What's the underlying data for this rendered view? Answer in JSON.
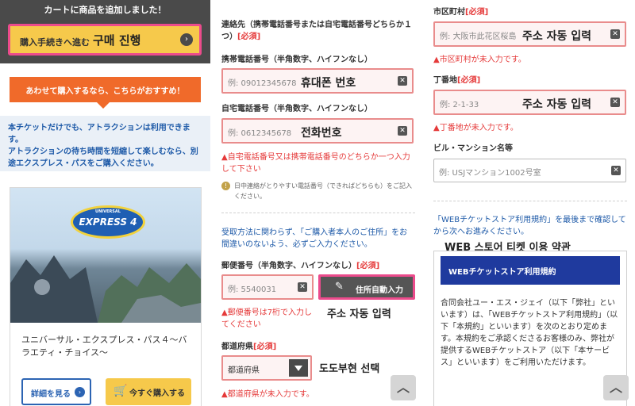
{
  "cart": {
    "message": "カートに商品を追加しました！",
    "checkout_jp": "購入手続きへ進む",
    "checkout_ko": "구매 진행",
    "chevron": "›"
  },
  "recommend": {
    "banner": "あわせて購入するなら、こちらがおすすめ！",
    "info": "本チケットだけでも、アトラクションは利用できます。\nアトラクションの待ち時間を短縮して楽しむなら、別途エクスプレス・パスをご購入ください。"
  },
  "product": {
    "logo_small": "UNIVERSAL",
    "logo_text": "EXPRESS 4",
    "name": "ユニバーサル・エクスプレス・パス４～バラエティ・チョイス～",
    "details_label": "詳細を見る",
    "details_chevron": "›",
    "cart_icon": "🛒",
    "buy_label": "今すぐ購入する"
  },
  "contact": {
    "label": "連絡先（携帯電話番号または自宅電話番号どちらか１つ）",
    "required": "[必須]",
    "mobile_label": "携帯電話番号（半角数字、ハイフンなし）",
    "mobile_placeholder": "例: 09012345678",
    "mobile_ko": "휴대폰 번호",
    "home_label": "自宅電話番号（半角数字、ハイフンなし）",
    "home_placeholder": "例: 0612345678",
    "home_ko": "전화번호",
    "error": "▲自宅電話番号又は携帯電話番号のどちらか一つ入力して下さい",
    "note_icon": "!",
    "daytime_note": "日中連絡がとりやすい電話番号（できればどちらも）をご記入ください。"
  },
  "address": {
    "note": "受取方法に関わらず、「ご購入者本人のご住所」をお間違いのないよう、必ずご入力ください。",
    "postal_label": "郵便番号（半角数字、ハイフンなし）",
    "postal_required": "[必須]",
    "postal_placeholder": "例: 5540031",
    "autofill_icon": "✎",
    "autofill_label": "住所自動入力",
    "postal_error": "▲郵便番号は7桁で入力してください",
    "autofill_ko": "주소 자동 입력",
    "pref_label": "都道府県",
    "pref_required": "[必須]",
    "pref_value": "都道府県",
    "pref_ko": "도도부현 선택",
    "pref_error": "▲都道府県が未入力です。",
    "city_label": "市区町村",
    "city_required": "[必須]",
    "city_placeholder": "例: 大阪市此花区桜島",
    "city_ko": "주소 자동 입력",
    "city_error": "▲市区町村が未入力です。",
    "block_label": "丁番地",
    "block_required": "[必須]",
    "block_placeholder": "例: 2-1-33",
    "block_ko": "주소 자동 입력",
    "block_error": "▲丁番地が未入力です。",
    "bldg_label": "ビル・マンション名等",
    "bldg_placeholder": "例: USJマンション1002号室"
  },
  "terms": {
    "note": "「WEBチケットストア利用規約」を最後まで確認してから次へお進みください。",
    "ko": "WEB 스토어 티켓 이용 약관",
    "heading": "WEBチケットストア利用規約",
    "body": "合同会社ユー・エス・ジェイ（以下「弊社」といいます）は、「WEBチケットストア利用規約」（以下「本規約」といいます）を次のとおり定めます。本規約をご承認くださるお客様のみ、弊社が提供するWEBチケットストア（以下「本サービス」といいます）をご利用いただけます。"
  },
  "ui": {
    "clear": "✕",
    "scroll_top": "︿"
  }
}
